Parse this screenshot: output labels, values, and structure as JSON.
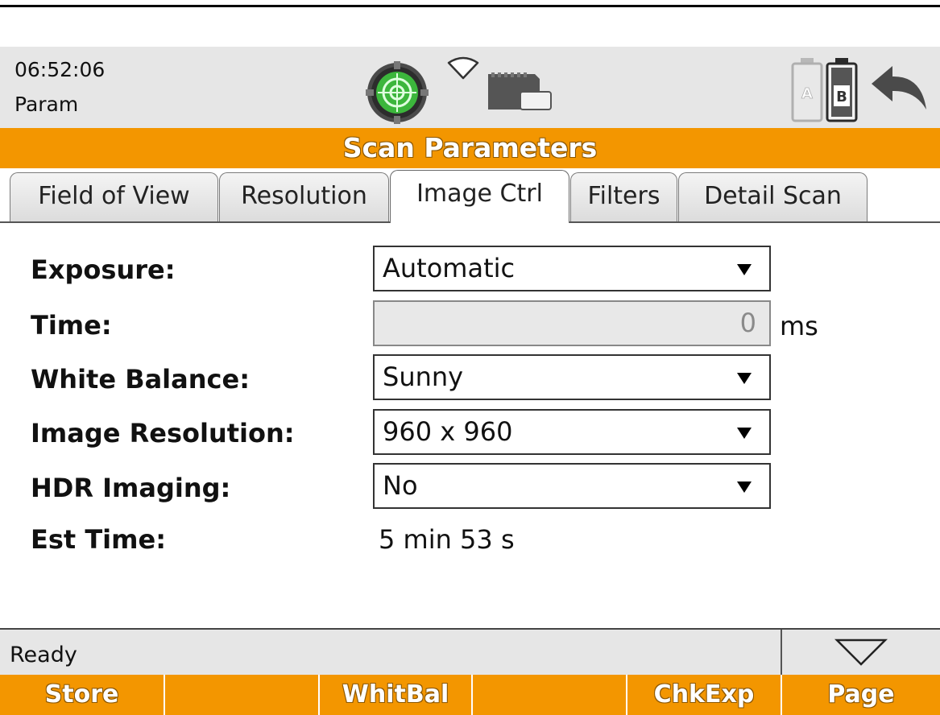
{
  "header": {
    "time": "06:52:06",
    "mode": "Param",
    "icons": [
      "level-bubble-icon",
      "wifi-icon",
      "sd-card-icon",
      "battery-a-icon",
      "battery-b-icon",
      "back-arrow-icon"
    ],
    "battery_a_label": "A",
    "battery_b_label": "B"
  },
  "title": "Scan Parameters",
  "tabs": [
    {
      "label": "Field of View",
      "active": false
    },
    {
      "label": "Resolution",
      "active": false
    },
    {
      "label": "Image Ctrl",
      "active": true
    },
    {
      "label": "Filters",
      "active": false
    },
    {
      "label": "Detail Scan",
      "active": false
    }
  ],
  "form": {
    "exposure": {
      "label": "Exposure:",
      "value": "Automatic"
    },
    "time": {
      "label": "Time:",
      "value": "0",
      "unit": "ms",
      "disabled": true
    },
    "white_balance": {
      "label": "White Balance:",
      "value": "Sunny"
    },
    "image_resolution": {
      "label": "Image Resolution:",
      "value": "960 x 960"
    },
    "hdr_imaging": {
      "label": "HDR Imaging:",
      "value": "No"
    },
    "est_time": {
      "label": "Est Time:",
      "value": "5 min 53 s"
    }
  },
  "status": {
    "text": "Ready"
  },
  "softkeys": [
    {
      "label": "Store"
    },
    {
      "label": ""
    },
    {
      "label": "WhitBal"
    },
    {
      "label": ""
    },
    {
      "label": "ChkExp"
    },
    {
      "label": "Page"
    }
  ],
  "colors": {
    "accent": "#f39600",
    "header_bg": "#e6e6e6",
    "level_green": "#3cb63c"
  }
}
